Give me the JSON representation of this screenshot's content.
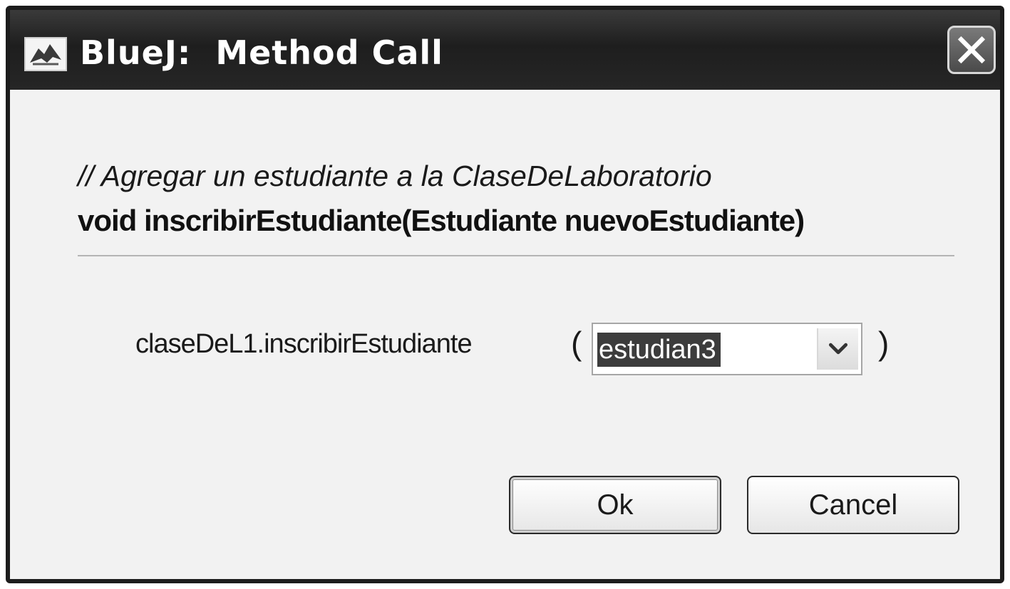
{
  "window": {
    "title": "BlueJ:  Method Call",
    "close_icon": "close-x-icon",
    "app_icon": "bluej-bird-icon"
  },
  "method": {
    "comment": "// Agregar un estudiante a la ClaseDeLaboratorio",
    "signature": "void inscribirEstudiante(Estudiante nuevoEstudiante)"
  },
  "call": {
    "label": "claseDeL1.inscribirEstudiante",
    "open_paren": "(",
    "close_paren": ")",
    "argument": {
      "selected_value": "estudian3",
      "dropdown_icon": "chevron-down-icon"
    }
  },
  "buttons": {
    "ok_label": "Ok",
    "cancel_label": "Cancel"
  }
}
